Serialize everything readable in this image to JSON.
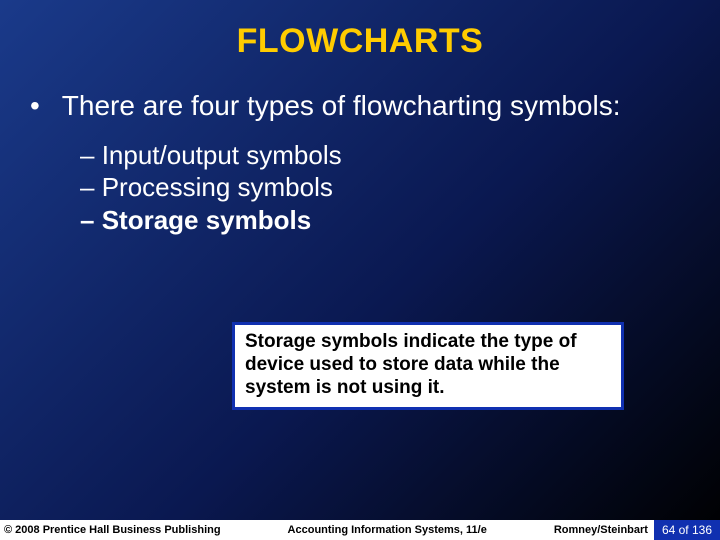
{
  "title": "FLOWCHARTS",
  "main_bullet": "There are four types of flowcharting symbols:",
  "sub_items": {
    "a": "Input/output symbols",
    "b": "Processing symbols",
    "c": "Storage symbols"
  },
  "callout": "Storage symbols indicate the type of device used to store data while the system is not using it.",
  "footer": {
    "copyright": "© 2008 Prentice Hall Business Publishing",
    "book": "Accounting Information Systems, 11/e",
    "authors": "Romney/Steinbart",
    "page": "64 of 136"
  }
}
